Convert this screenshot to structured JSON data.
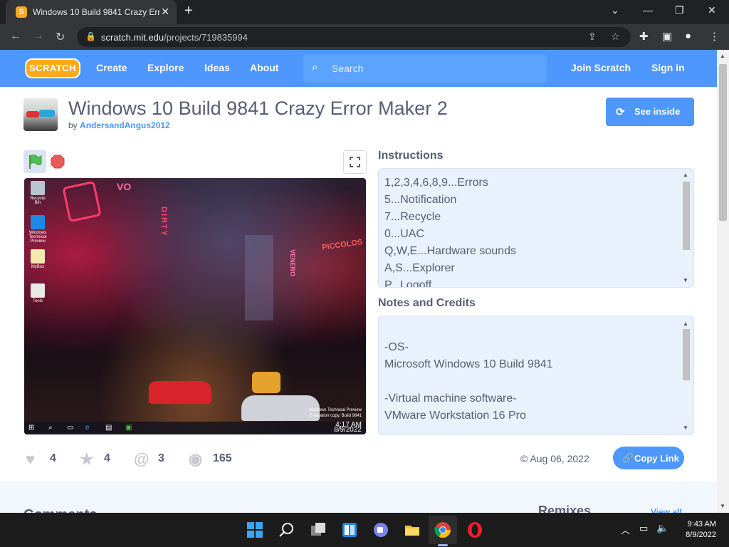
{
  "browser": {
    "tab_title": "Windows 10 Build 9841 Crazy Err",
    "url_host": "scratch.mit.edu",
    "url_path": "/projects/719835994"
  },
  "scratch_nav": {
    "logo": "SCRATCH",
    "links": [
      "Create",
      "Explore",
      "Ideas",
      "About"
    ],
    "search_placeholder": "Search",
    "join": "Join Scratch",
    "signin": "Sign in"
  },
  "project": {
    "title": "Windows 10 Build 9841 Crazy Error Maker 2",
    "by": "by",
    "author": "AndersandAngus2012",
    "see_inside": "See inside"
  },
  "stage": {
    "desktop_icons": [
      "Recycle Bin",
      "Windows Technical Preview",
      "MyBox",
      "Tools"
    ],
    "neon_signs": [
      "DIRTY",
      "PICCOLOS",
      "VENERO"
    ],
    "watermark_line1": "Windows Technical Preview",
    "watermark_line2": "Evaluation copy. Build 9841",
    "taskbar_time": "4:17 AM",
    "taskbar_date": "8/9/2022"
  },
  "instructions": {
    "heading": "Instructions",
    "lines": [
      "1,2,3,4,6,8,9...Errors",
      "5...Notification",
      "7...Recycle",
      "0...UAC",
      "Q,W,E...Hardware sounds",
      "A,S...Explorer",
      "P...Logoff"
    ]
  },
  "notes": {
    "heading": "Notes and Credits",
    "lines": [
      "",
      "-OS-",
      "Microsoft Windows 10 Build 9841",
      "",
      "-Virtual machine software-",
      "VMware Workstation 16 Pro"
    ]
  },
  "stats": {
    "loves": "4",
    "favorites": "4",
    "remixes": "3",
    "views": "165"
  },
  "shared_date": "© Aug 06, 2022",
  "copy_link": "Copy Link",
  "lower": {
    "comments": "Comments",
    "remixes": "Remixes",
    "view_all": "View all"
  },
  "windows_taskbar": {
    "time": "9:43 AM",
    "date": "8/9/2022"
  }
}
